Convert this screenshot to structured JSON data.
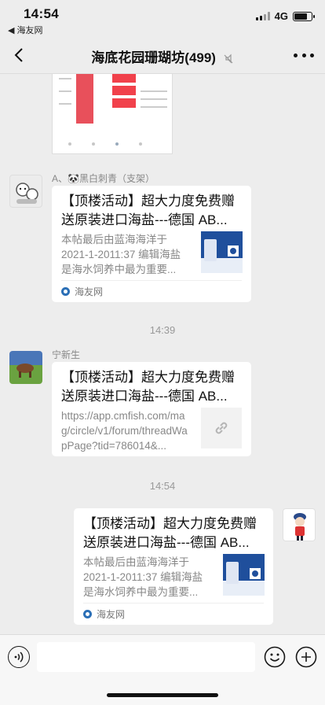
{
  "status_bar": {
    "time": "14:54",
    "back_app": "◀ 海友网",
    "network": "4G"
  },
  "nav": {
    "title": "海底花园珊瑚坊(499)"
  },
  "messages": [
    {
      "sender": "A、🐼黑白刺青（支架）",
      "title": "【顶楼活动】超大力度免费赠送原装进口海盐---德国 AB...",
      "desc": "本帖最后由蓝海海洋于\n2021-1-2011:37 编辑海盐\n是海水饲养中最为重要...",
      "source": "海友网"
    },
    {
      "timestamp": "14:39"
    },
    {
      "sender": "宁新生",
      "title": "【顶楼活动】超大力度免费赠送原装进口海盐---德国 AB...",
      "url": "https://app.cmfish.com/mag/circle/v1/forum/threadWapPage?tid=786014&..."
    },
    {
      "timestamp": "14:54"
    },
    {
      "title": "【顶楼活动】超大力度免费赠送原装进口海盐---德国 AB...",
      "desc": "本帖最后由蓝海海洋于\n2021-1-2011:37 编辑海盐\n是海水饲养中最为重要...",
      "source": "海友网"
    }
  ],
  "input": {
    "placeholder": ""
  },
  "colors": {
    "background": "#ededed",
    "card": "#ffffff",
    "muted_text": "#888888",
    "site_icon": "#2b6fb6"
  }
}
